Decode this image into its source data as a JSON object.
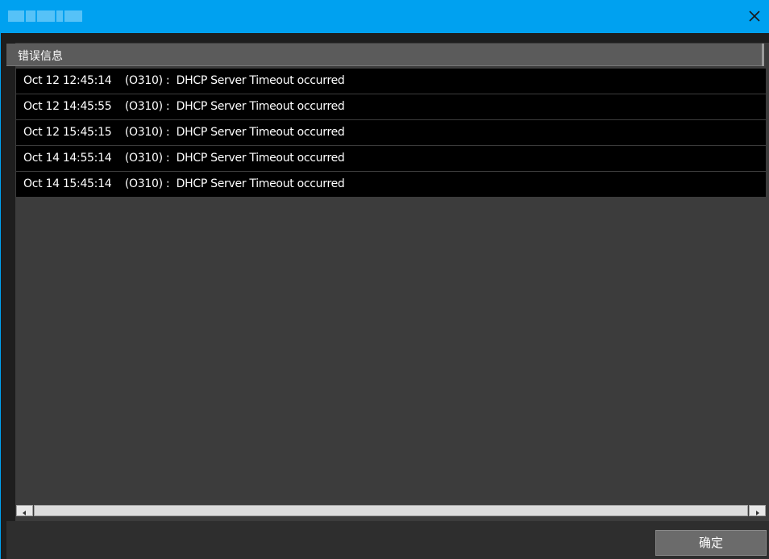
{
  "window": {
    "title_obscured": true,
    "accent_color": "#00a1f0",
    "close_icon": "close-icon"
  },
  "list": {
    "header": "错误信息",
    "rows": [
      "Oct 12 12:45:14    (O310) :  DHCP Server Timeout occurred",
      "Oct 12 14:45:55    (O310) :  DHCP Server Timeout occurred",
      "Oct 12 15:45:15    (O310) :  DHCP Server Timeout occurred",
      "Oct 14 14:55:14    (O310) :  DHCP Server Timeout occurred",
      "Oct 14 15:45:14    (O310) :  DHCP Server Timeout occurred"
    ]
  },
  "scrollbar": {
    "left_icon": "arrow-left-icon",
    "right_icon": "arrow-right-icon"
  },
  "footer": {
    "ok_label": "确定"
  }
}
